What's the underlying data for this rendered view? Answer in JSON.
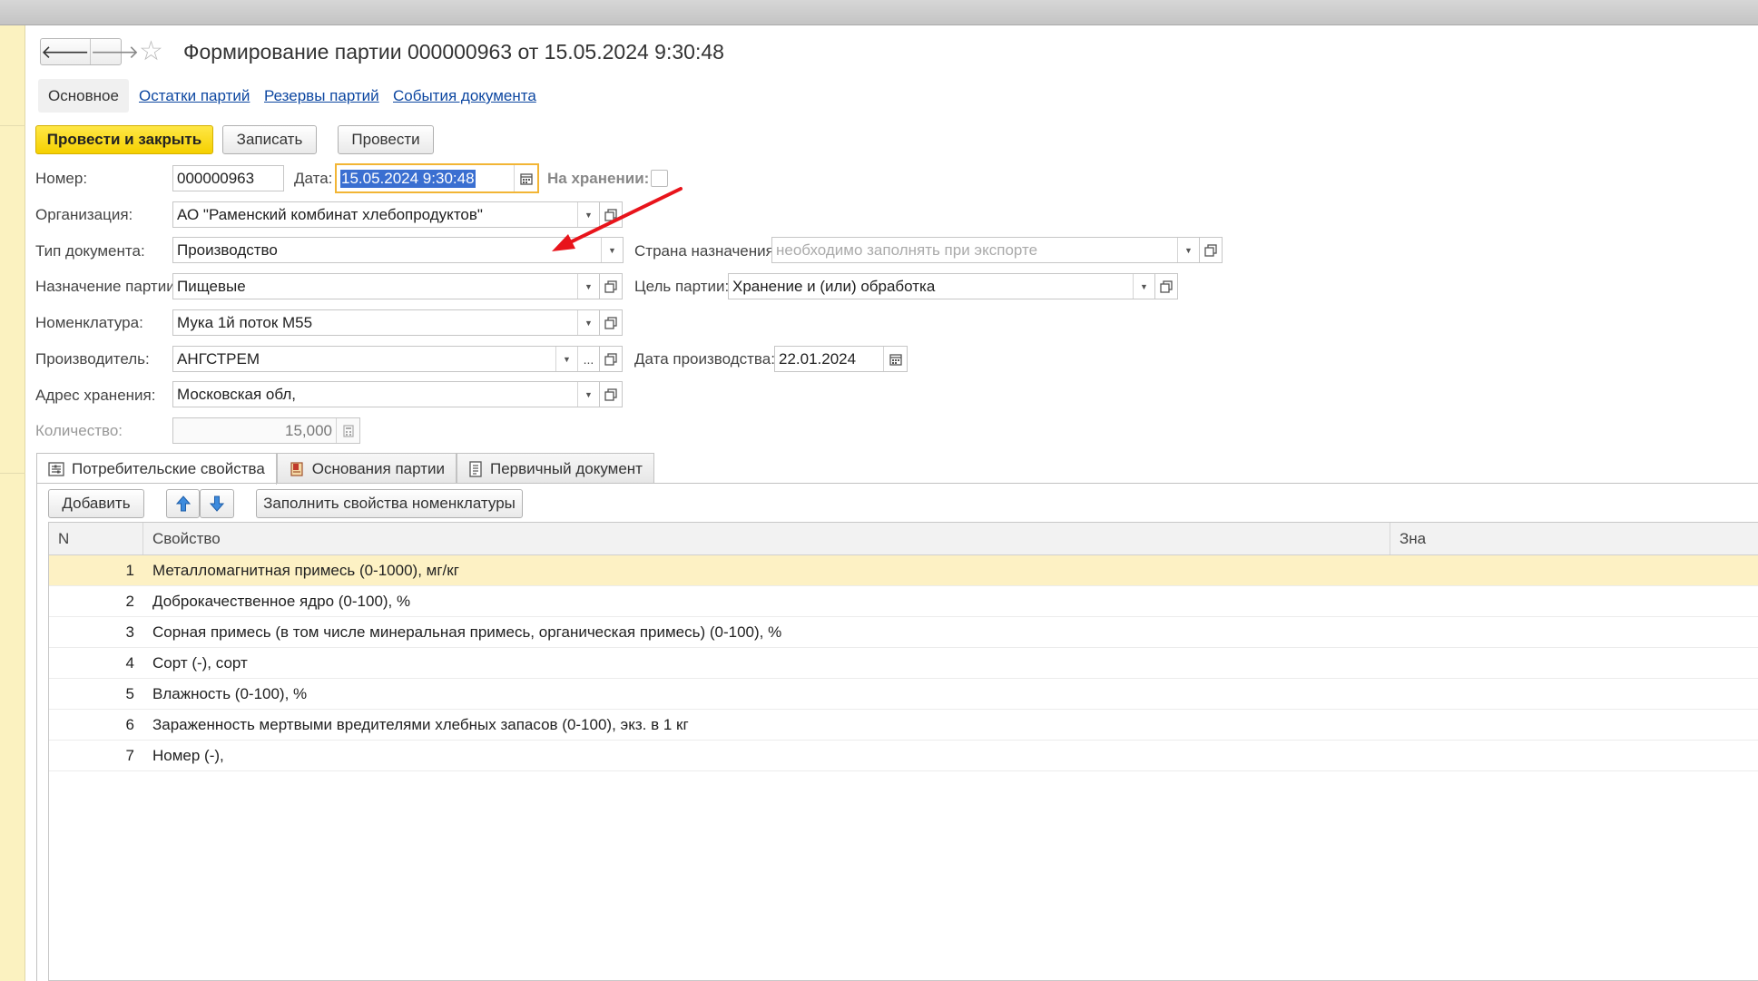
{
  "window": {
    "title": "Формирование партии 000000963 от 15.05.2024 9:30:48"
  },
  "nav": {
    "back_glyph": "🡐",
    "forward_glyph": "🡒",
    "favorite_glyph": "☆"
  },
  "section_tabs": {
    "current": "Основное",
    "links": [
      "Остатки партий",
      "Резервы партий",
      "События документа"
    ]
  },
  "toolbar": {
    "post_and_close": "Провести и закрыть",
    "save": "Записать",
    "post": "Провести"
  },
  "form": {
    "number_label": "Номер:",
    "number_value": "000000963",
    "date_label": "Дата:",
    "date_value": "15.05.2024  9:30:48",
    "storage_label": "На хранении:",
    "org_label": "Организация:",
    "org_value": "АО \"Раменский комбинат хлебопродуктов\"",
    "doctype_label": "Тип документа:",
    "doctype_value": "Производство",
    "country_label": "Страна назначения:",
    "country_placeholder": "необходимо заполнять при экспорте",
    "purpose_label": "Назначение партии:",
    "purpose_value": "Пищевые",
    "goal_label": "Цель партии:",
    "goal_value": "Хранение и (или) обработка",
    "nomenclature_label": "Номенклатура:",
    "nomenclature_value": "Мука 1й поток М55",
    "producer_label": "Производитель:",
    "producer_value": "АНГСТРЕМ",
    "prod_date_label": "Дата производства:",
    "prod_date_value": "22.01.2024",
    "address_label": "Адрес хранения:",
    "address_value": "Московская обл,",
    "qty_label": "Количество:",
    "qty_value": "15,000",
    "dots": "..."
  },
  "inner_tabs": [
    "Потребительские свойства",
    "Основания партии",
    "Первичный документ"
  ],
  "table_toolbar": {
    "add": "Добавить",
    "fill": "Заполнить свойства номенклатуры"
  },
  "table": {
    "columns": [
      "N",
      "Свойство",
      "Зна"
    ],
    "rows": [
      {
        "n": "1",
        "prop": "Металломагнитная примесь (0-1000), мг/кг"
      },
      {
        "n": "2",
        "prop": "Доброкачественное ядро (0-100), %"
      },
      {
        "n": "3",
        "prop": "Сорная примесь (в том числе минеральная примесь, органическая примесь) (0-100), %"
      },
      {
        "n": "4",
        "prop": "Сорт (-), сорт"
      },
      {
        "n": "5",
        "prop": "Влажность (0-100), %"
      },
      {
        "n": "6",
        "prop": "Зараженность мертвыми вредителями хлебных запасов (0-100), экз. в 1 кг"
      },
      {
        "n": "7",
        "prop": "Номер (-),"
      }
    ]
  },
  "colors": {
    "primary_button": "#f5d000",
    "focus_border": "#f2b535",
    "current_row": "#fdf1c4",
    "link": "#0d47a1",
    "annotation_arrow": "#e8141b"
  }
}
